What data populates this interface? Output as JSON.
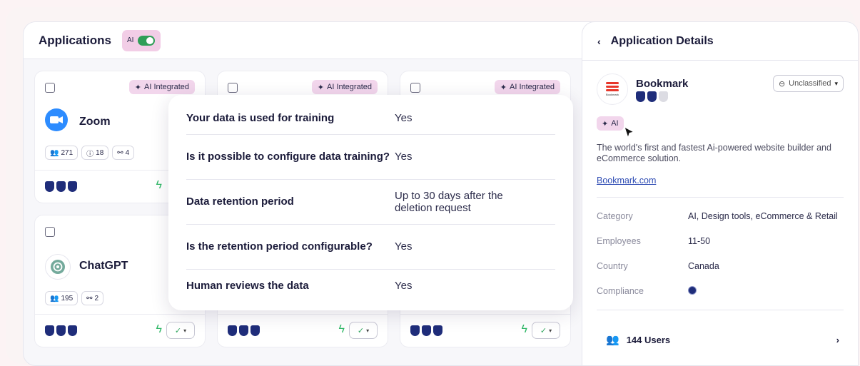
{
  "apps": {
    "title": "Applications",
    "ai_toggle_label": "AI",
    "ai_toggle_on": true,
    "badge_label": "AI Integrated",
    "cards": [
      {
        "name": "Zoom",
        "logo": "zoom-logo",
        "stats": {
          "users": "271",
          "issues": "18",
          "integrations": "4"
        },
        "badge": true,
        "trust_level": 3
      },
      {
        "name": "",
        "badge": true
      },
      {
        "name": "",
        "badge": true
      },
      {
        "name": "ChatGPT",
        "logo": "chatgpt-logo",
        "stats": {
          "users": "195",
          "integrations": "2"
        },
        "badge": false,
        "trust_level": 3
      },
      {
        "name": "",
        "trust_level": 3
      },
      {
        "name": "",
        "trust_level": 3
      }
    ]
  },
  "popover": {
    "rows": [
      {
        "question": "Your data is used for training",
        "answer": "Yes"
      },
      {
        "question": "Is it possible to configure data training?",
        "answer": "Yes"
      },
      {
        "question": "Data retention period",
        "answer": "Up to 30 days after the deletion request"
      },
      {
        "question": "Is the retention period configurable?",
        "answer": "Yes"
      },
      {
        "question": "Human reviews the data",
        "answer": "Yes"
      }
    ]
  },
  "details": {
    "title": "Application Details",
    "back_icon": "chevron-left-icon",
    "app_name": "Bookmark",
    "logo_text": "Bookmark",
    "classification": "Unclassified",
    "ai_tag": "AI",
    "description": "The world's first and fastest Ai-powered website builder and eCommerce solution.",
    "website": "Bookmark.com",
    "info": [
      {
        "key": "Category",
        "value": "AI, Design tools, eCommerce & Retail"
      },
      {
        "key": "Employees",
        "value": "11-50"
      },
      {
        "key": "Country",
        "value": "Canada"
      },
      {
        "key": "Compliance",
        "value": ""
      }
    ],
    "users_label": "144 Users",
    "trust_level": 2
  },
  "colors": {
    "accent": "#1f2d7a",
    "ai_badge": "#f2d6ec",
    "toggle_on": "#2f9e57",
    "bolt": "#2fb866"
  }
}
